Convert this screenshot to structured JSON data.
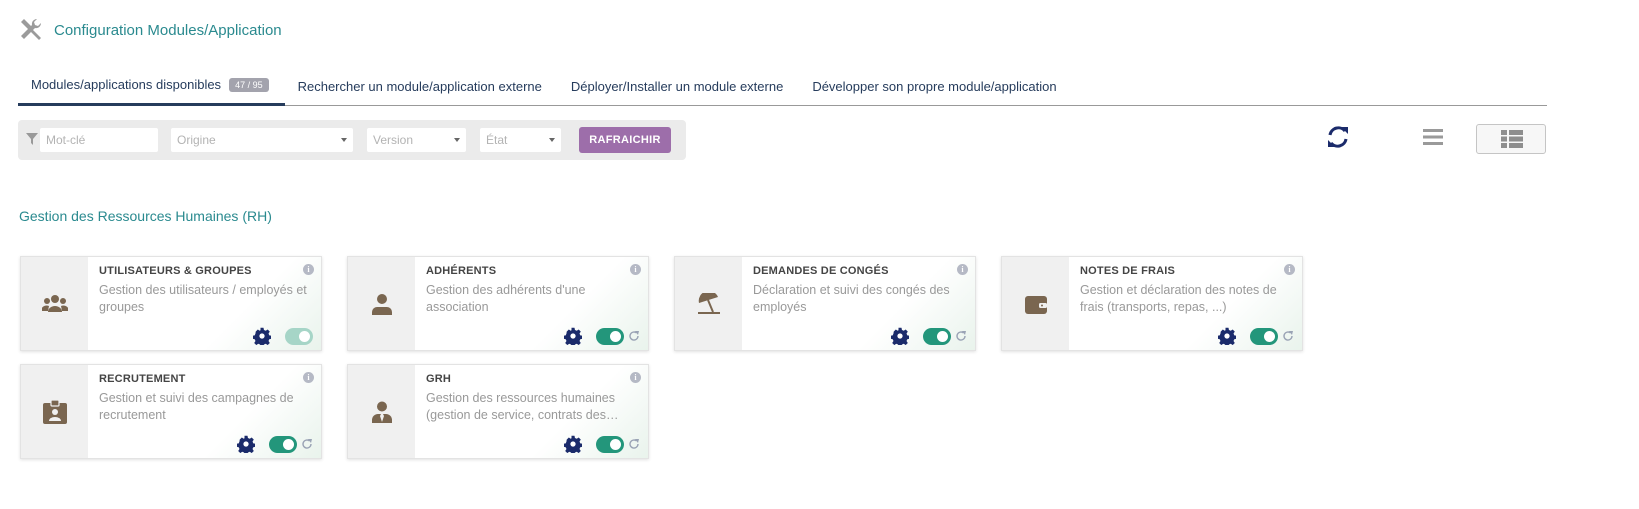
{
  "header": {
    "title": "Configuration Modules/Application",
    "icon": "tools-icon"
  },
  "tabs": [
    {
      "label": "Modules/applications disponibles",
      "badge": "47 / 95",
      "active": true
    },
    {
      "label": "Rechercher un module/application externe"
    },
    {
      "label": "Déployer/Installer un module externe"
    },
    {
      "label": "Développer son propre module/application"
    }
  ],
  "filters": {
    "keyword_placeholder": "Mot-clé",
    "origin_placeholder": "Origine",
    "version_placeholder": "Version",
    "state_placeholder": "État",
    "refresh_label": "RAFRAICHIR"
  },
  "section": {
    "title": "Gestion des Ressources Humaines (RH)"
  },
  "modules": [
    {
      "name": "UTILISATEURS & GROUPES",
      "description": "Gestion des utilisateurs / employés et groupes",
      "icon": "users-icon",
      "enabled": true,
      "locked": true
    },
    {
      "name": "ADHÉRENTS",
      "description": "Gestion des adhérents d'une association",
      "icon": "user-icon",
      "enabled": true
    },
    {
      "name": "DEMANDES DE CONGÉS",
      "description": "Déclaration et suivi des congés des employés",
      "icon": "beach-umbrella-icon",
      "enabled": true
    },
    {
      "name": "NOTES DE FRAIS",
      "description": "Gestion et déclaration des notes de frais (transports, repas, ...)",
      "icon": "wallet-icon",
      "enabled": true
    },
    {
      "name": "RECRUTEMENT",
      "description": "Gestion et suivi des campagnes de recrutement",
      "icon": "id-badge-icon",
      "enabled": true
    },
    {
      "name": "GRH",
      "description": "Gestion des ressources humaines (gestion de service, contrats des…",
      "icon": "user-tie-icon",
      "enabled": true
    }
  ],
  "colors": {
    "accent": "#2a8a8f",
    "nav": "#263c5c",
    "toggle_on": "#23967b",
    "button": "#9d6eaa",
    "icon_brown": "#7a6650"
  }
}
